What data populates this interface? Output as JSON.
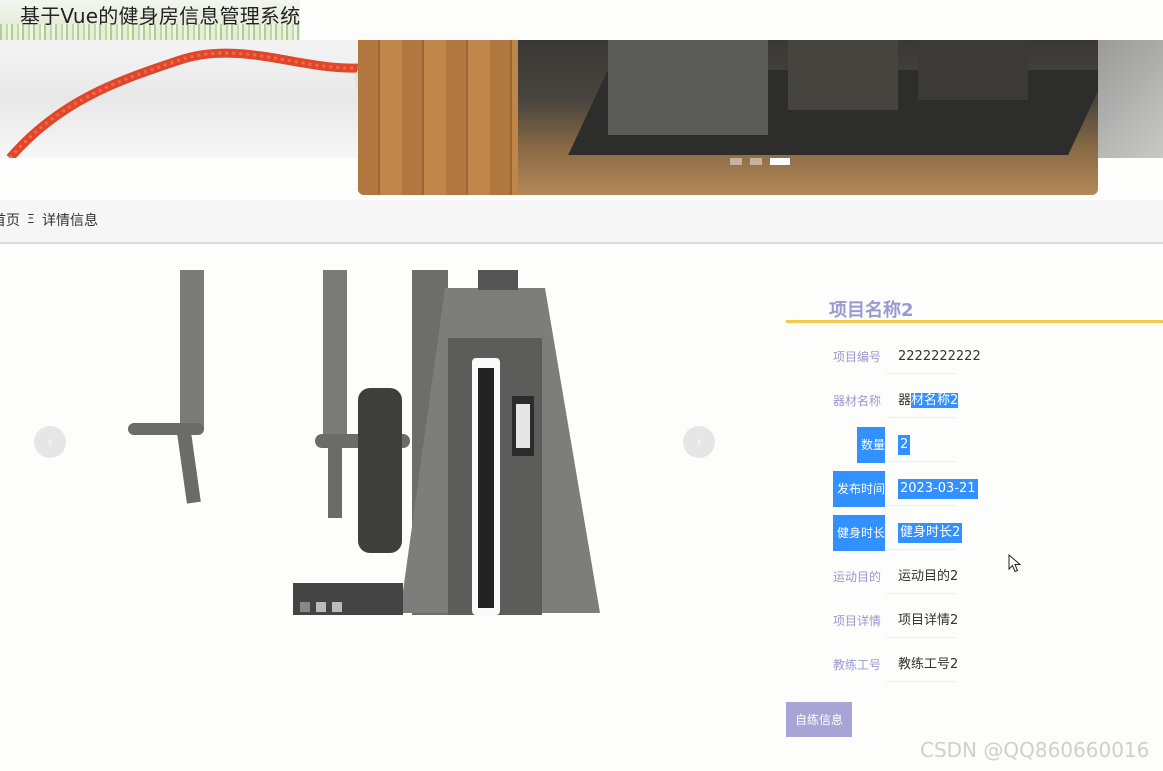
{
  "header": {
    "title": "基于Vue的健身房信息管理系统"
  },
  "banner": {
    "dots_total": 3,
    "active_dot": 3
  },
  "breadcrumb": {
    "home": "首页",
    "separator": "Ξ",
    "current": "详情信息"
  },
  "gallery": {
    "prev_icon": "‹",
    "next_icon": "›",
    "dots_total": 3,
    "active_dot": 1
  },
  "detail": {
    "title": "项目名称2",
    "rows": [
      {
        "label": "项目编号",
        "value": "2222222222"
      },
      {
        "label": "器材名称",
        "value": "器材名称2"
      },
      {
        "label": "数量",
        "value": "2"
      },
      {
        "label": "发布时间",
        "value": "2023-03-21"
      },
      {
        "label": "健身时长",
        "value": "健身时长2"
      },
      {
        "label": "运动目的",
        "value": "运动目的2"
      },
      {
        "label": "项目详情",
        "value": "项目详情2"
      },
      {
        "label": "教练工号",
        "value": "教练工号2"
      }
    ],
    "action_button": "自练信息"
  },
  "watermark": "CSDN @QQ860660016",
  "colors": {
    "accent": "#9a99d0",
    "selection": "#3390ff",
    "button": "#a7a5d6",
    "zigzag": "#f2c94c"
  }
}
